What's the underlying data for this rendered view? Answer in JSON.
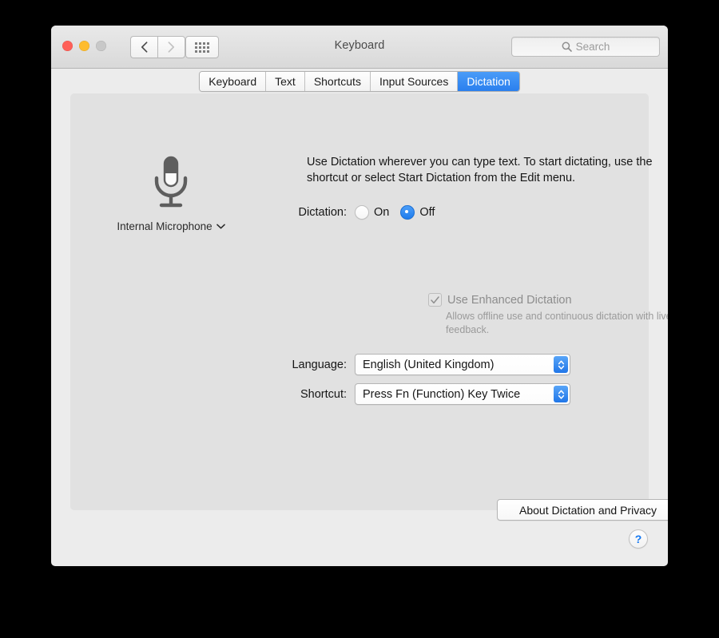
{
  "window": {
    "title": "Keyboard",
    "traffic_lights": [
      "close",
      "minimize",
      "zoom"
    ],
    "nav": {
      "back": "back-chevron",
      "forward": "forward-chevron",
      "show_all": "grid-icon"
    },
    "search": {
      "placeholder": "Search",
      "value": "",
      "icon": "search-icon"
    }
  },
  "tabs": [
    {
      "label": "Keyboard",
      "selected": false
    },
    {
      "label": "Text",
      "selected": false
    },
    {
      "label": "Shortcuts",
      "selected": false
    },
    {
      "label": "Input Sources",
      "selected": false
    },
    {
      "label": "Dictation",
      "selected": true
    }
  ],
  "panel": {
    "microphone": {
      "icon": "microphone-icon",
      "label": "Internal Microphone",
      "chevron": "chevron-down-icon"
    },
    "description": "Use Dictation wherever you can type text. To start dictating, use the shortcut or select Start Dictation from the Edit menu.",
    "dictation": {
      "label": "Dictation:",
      "options": [
        {
          "label": "On",
          "selected": false
        },
        {
          "label": "Off",
          "selected": true
        }
      ]
    },
    "enhanced": {
      "label": "Use Enhanced Dictation",
      "checked": true,
      "enabled": false,
      "checkmark": "checkmark-icon",
      "note": "Allows offline use and continuous dictation with live feedback."
    },
    "language": {
      "label": "Language:",
      "value": "English (United Kingdom)",
      "arrows": "chevron-up-down-icon"
    },
    "shortcut": {
      "label": "Shortcut:",
      "value": "Press Fn (Function) Key Twice",
      "arrows": "chevron-up-down-icon"
    },
    "about_button": "About Dictation and Privacy"
  },
  "help": {
    "label": "?",
    "icon": "help-icon"
  },
  "colors": {
    "accent_blue": "#2a7fee",
    "window_bg": "#ececec",
    "panel_bg": "#e1e1e1",
    "close": "#ff5f57",
    "minimize": "#febc2e",
    "zoom": "#c8c8c8",
    "disabled_text": "#8c8c8c"
  }
}
